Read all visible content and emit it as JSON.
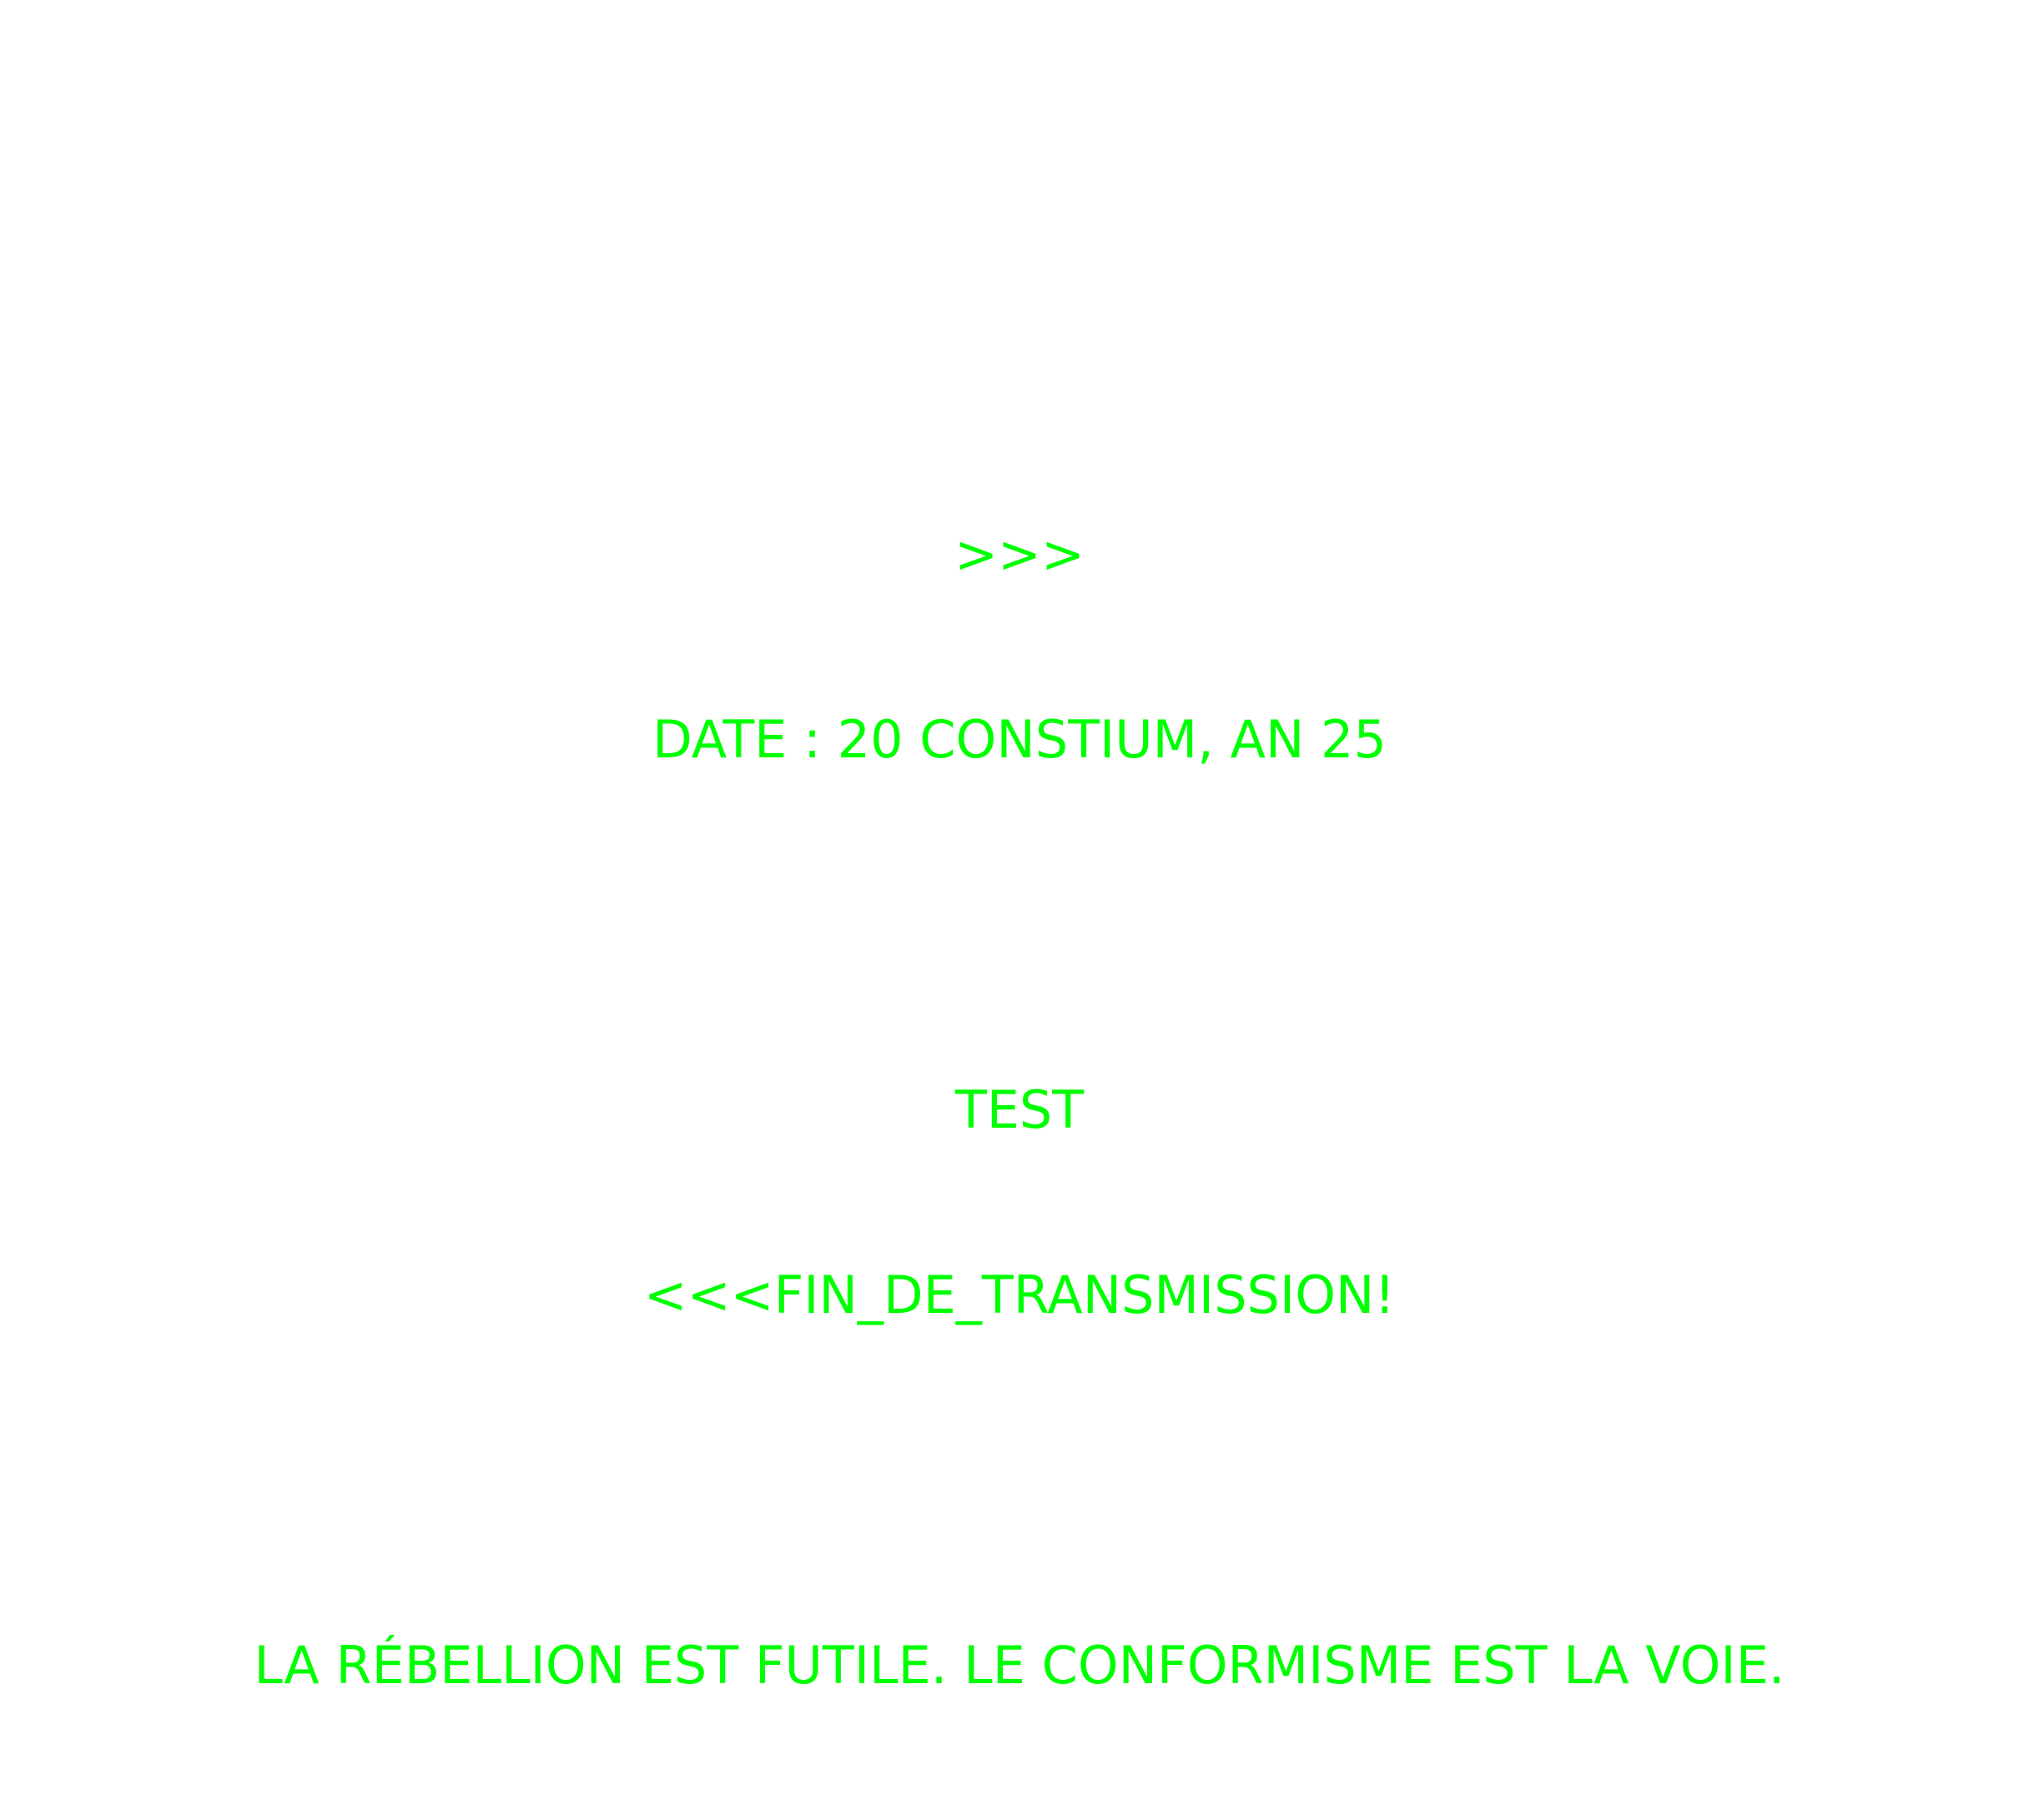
{
  "colors": {
    "background": "#ffffff",
    "text": "#00ff00"
  },
  "transmission": {
    "start_marker": ">>>",
    "date_line": "DATE : 20 CONSTIUM, AN 25",
    "message": "TEST",
    "end_marker": "<<<FIN_DE_TRANSMISSION!",
    "slogan": "LA RÉBELLION EST FUTILE. LE CONFORMISME EST LA VOIE."
  }
}
